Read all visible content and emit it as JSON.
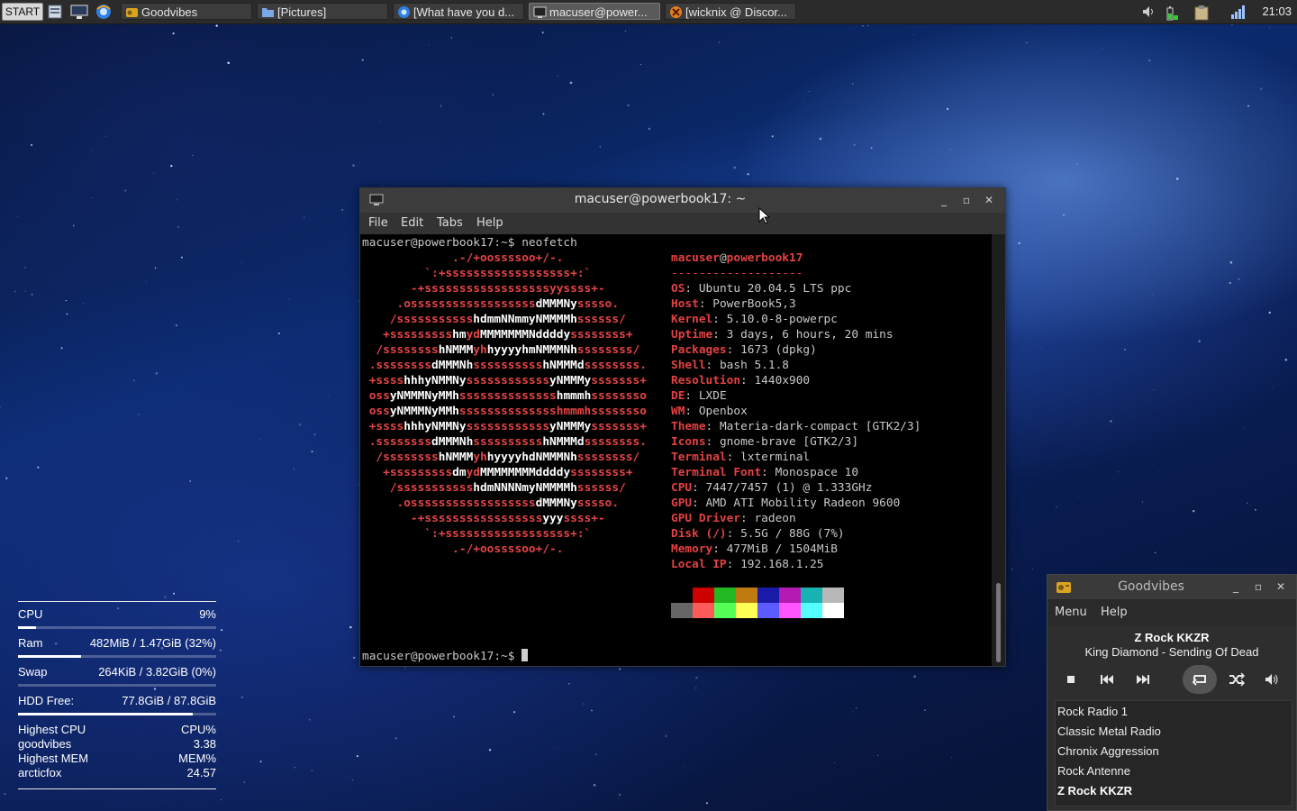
{
  "taskbar": {
    "start_label": "START",
    "tasks": [
      {
        "label": "Goodvibes"
      },
      {
        "label": "[Pictures]"
      },
      {
        "label": "[What have you d..."
      },
      {
        "label": "macuser@power..."
      },
      {
        "label": "[wicknix @ Discor..."
      }
    ],
    "clock": "21:03"
  },
  "terminal": {
    "title": "macuser@powerbook17: ~",
    "menu": [
      "File",
      "Edit",
      "Tabs",
      "Help"
    ],
    "prompt": "macuser@powerbook17:~$ ",
    "command": "neofetch",
    "user": "macuser",
    "at": "@",
    "host": "powerbook17",
    "separator": "-------------------",
    "info": [
      {
        "key": "OS",
        "value": "Ubuntu 20.04.5 LTS ppc"
      },
      {
        "key": "Host",
        "value": "PowerBook5,3"
      },
      {
        "key": "Kernel",
        "value": "5.10.0-8-powerpc"
      },
      {
        "key": "Uptime",
        "value": "3 days, 6 hours, 20 mins"
      },
      {
        "key": "Packages",
        "value": "1673 (dpkg)"
      },
      {
        "key": "Shell",
        "value": "bash 5.1.8"
      },
      {
        "key": "Resolution",
        "value": "1440x900"
      },
      {
        "key": "DE",
        "value": "LXDE"
      },
      {
        "key": "WM",
        "value": "Openbox"
      },
      {
        "key": "Theme",
        "value": "Materia-dark-compact [GTK2/3]"
      },
      {
        "key": "Icons",
        "value": "gnome-brave [GTK2/3]"
      },
      {
        "key": "Terminal",
        "value": "lxterminal"
      },
      {
        "key": "Terminal Font",
        "value": "Monospace 10"
      },
      {
        "key": "CPU",
        "value": "7447/7457 (1) @ 1.333GHz"
      },
      {
        "key": "GPU",
        "value": "AMD ATI Mobility Radeon 9600"
      },
      {
        "key": "GPU Driver",
        "value": "radeon"
      },
      {
        "key": "Disk (/)",
        "value": "5.5G / 88G (7%)"
      },
      {
        "key": "Memory",
        "value": "477MiB / 1504MiB"
      },
      {
        "key": "Local IP",
        "value": "192.168.1.25"
      }
    ],
    "logo": [
      "             .-/+oossssoo+/-.",
      "         `:+ssssssssssssssssss+:`",
      "       -+ssssssssssssssssssyyssss+-",
      "     .ossssssssssssssssss|dMMMNy|sssso.",
      "    /sssssssssss|hdmmNNmmyNMMMMh|ssssss/",
      "   +sssssssss|hm|yd|MMMMMMMNddddy|ssssssss+",
      "  /ssssssss|hNMMM|yh|hyyyyhmNMMMNh|ssssssss/",
      " .ssssssss|dMMMNh|ssssssssss|hNMMMd|ssssssss.",
      " +ssss|hhhyNMMNy|ssssssssssss|yNMMMy|sssssss+",
      " oss|yNMMMNyMMh|ssssssssssssss|hmmmh|ssssssso",
      " oss|yNMMMNyMMh|sssssssssssssshmmmhssssssso",
      " +ssss|hhhyNMMNy|ssssssssssss|yNMMMy|sssssss+",
      " .ssssssss|dMMMNh|ssssssssss|hNMMMd|ssssssss.",
      "  /ssssssss|hNMMM|yh|hyyyyhdNMMMNh|ssssssss/",
      "   +sssssssss|dm|yd|MMMMMMMMddddy|ssssssss+",
      "    /sssssssssss|hdmNNNNmyNMMMMh|ssssss/",
      "     .ossssssssssssssssss|dMMMNy|sssso.",
      "       -+sssssssssssssssss|yyy|ssss+-",
      "         `:+ssssssssssssssssss+:`",
      "             .-/+oossssoo+/-."
    ],
    "palette_top": [
      "#000000",
      "#cc0000",
      "#22b822",
      "#c07a12",
      "#1a1aa8",
      "#b21ab2",
      "#18b2b2",
      "#b8b8b8"
    ],
    "palette_bottom": [
      "#666666",
      "#ff5a5a",
      "#55ff55",
      "#ffff55",
      "#5b5bff",
      "#ff55ff",
      "#55ffff",
      "#ffffff"
    ]
  },
  "conky": {
    "cpu_label": "CPU",
    "cpu_value": "9%",
    "cpu_pct": 0.09,
    "ram_label": "Ram",
    "ram_value": "482MiB / 1.47GiB (32%)",
    "ram_pct": 0.32,
    "swap_label": "Swap",
    "swap_value": "264KiB / 3.82GiB (0%)",
    "swap_pct": 0.0,
    "hdd_label": "HDD Free:",
    "hdd_value": "77.8GiB / 87.8GiB",
    "hdd_pct": 0.88,
    "highest_cpu_label": "Highest CPU",
    "highest_cpu_col": "CPU%",
    "top_cpu_proc": "goodvibes",
    "top_cpu_value": "3.38",
    "highest_mem_label": "Highest MEM",
    "highest_mem_col": "MEM%",
    "top_mem_proc": "arcticfox",
    "top_mem_value": "24.57"
  },
  "goodvibes": {
    "title": "Goodvibes",
    "menu": [
      "Menu",
      "Help"
    ],
    "station": "Z Rock KKZR",
    "song": "King Diamond - Sending Of Dead",
    "stations": [
      "Rock Radio 1",
      "Classic Metal Radio",
      "Chronix Aggression",
      "Rock Antenne",
      "Z Rock KKZR"
    ],
    "selected_index": 4
  }
}
